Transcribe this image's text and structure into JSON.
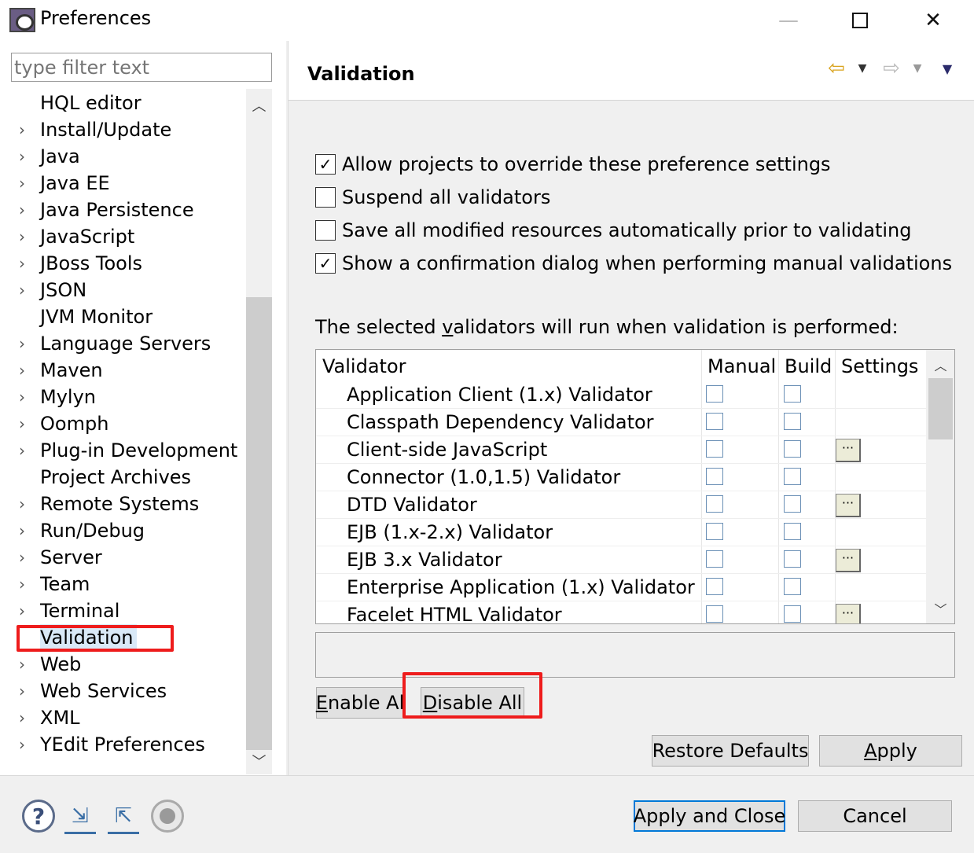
{
  "window": {
    "title": "Preferences",
    "minimize_glyph": "—",
    "close_glyph": "✕"
  },
  "filter": {
    "placeholder": "type filter text"
  },
  "tree": {
    "items": [
      {
        "label": "HQL editor",
        "expandable": false
      },
      {
        "label": "Install/Update",
        "expandable": true
      },
      {
        "label": "Java",
        "expandable": true
      },
      {
        "label": "Java EE",
        "expandable": true
      },
      {
        "label": "Java Persistence",
        "expandable": true
      },
      {
        "label": "JavaScript",
        "expandable": true
      },
      {
        "label": "JBoss Tools",
        "expandable": true
      },
      {
        "label": "JSON",
        "expandable": true
      },
      {
        "label": "JVM Monitor",
        "expandable": false
      },
      {
        "label": "Language Servers",
        "expandable": true
      },
      {
        "label": "Maven",
        "expandable": true
      },
      {
        "label": "Mylyn",
        "expandable": true
      },
      {
        "label": "Oomph",
        "expandable": true
      },
      {
        "label": "Plug-in Development",
        "expandable": true
      },
      {
        "label": "Project Archives",
        "expandable": false
      },
      {
        "label": "Remote Systems",
        "expandable": true
      },
      {
        "label": "Run/Debug",
        "expandable": true
      },
      {
        "label": "Server",
        "expandable": true
      },
      {
        "label": "Team",
        "expandable": true
      },
      {
        "label": "Terminal",
        "expandable": true
      },
      {
        "label": "Validation",
        "expandable": false,
        "selected": true
      },
      {
        "label": "Web",
        "expandable": true
      },
      {
        "label": "Web Services",
        "expandable": true
      },
      {
        "label": "XML",
        "expandable": true
      },
      {
        "label": "YEdit Preferences",
        "expandable": true
      }
    ]
  },
  "page": {
    "title": "Validation",
    "options": [
      {
        "label": "Allow projects to override these preference settings",
        "checked": true
      },
      {
        "label": "Suspend all validators",
        "checked": false
      },
      {
        "label": "Save all modified resources automatically prior to validating",
        "checked": false
      },
      {
        "label": "Show a confirmation dialog when performing manual validations",
        "checked": true
      }
    ],
    "description_pre": "The selected ",
    "description_accel": "v",
    "description_post": "alidators will run when validation is performed:",
    "table": {
      "headers": {
        "validator": "Validator",
        "manual": "Manual",
        "build": "Build",
        "settings": "Settings"
      },
      "settings_glyph": "···",
      "rows": [
        {
          "name": "Application Client (1.x) Validator",
          "manual": false,
          "build": false,
          "settings": false
        },
        {
          "name": "Classpath Dependency Validator",
          "manual": false,
          "build": false,
          "settings": false
        },
        {
          "name": "Client-side JavaScript",
          "manual": false,
          "build": false,
          "settings": true
        },
        {
          "name": "Connector (1.0,1.5) Validator",
          "manual": false,
          "build": false,
          "settings": false
        },
        {
          "name": "DTD Validator",
          "manual": false,
          "build": false,
          "settings": true
        },
        {
          "name": "EJB (1.x-2.x) Validator",
          "manual": false,
          "build": false,
          "settings": false
        },
        {
          "name": "EJB 3.x Validator",
          "manual": false,
          "build": false,
          "settings": true
        },
        {
          "name": "Enterprise Application (1.x) Validator",
          "manual": false,
          "build": false,
          "settings": false
        },
        {
          "name": "Facelet HTML Validator",
          "manual": false,
          "build": false,
          "settings": true
        }
      ]
    },
    "buttons": {
      "enable_all_accel": "E",
      "enable_all_rest": "nable Al",
      "disable_all_accel": "D",
      "disable_all_rest": "isable All",
      "restore_defaults": "Restore Defaults",
      "apply_accel": "A",
      "apply_rest": "pply"
    }
  },
  "footer": {
    "help_glyph": "?",
    "apply_and_close": "Apply and Close",
    "cancel": "Cancel"
  },
  "colors": {
    "annotation_red": "#ee1c1c",
    "selection_bg": "#d9e9f7",
    "default_button_border": "#0078d7"
  }
}
